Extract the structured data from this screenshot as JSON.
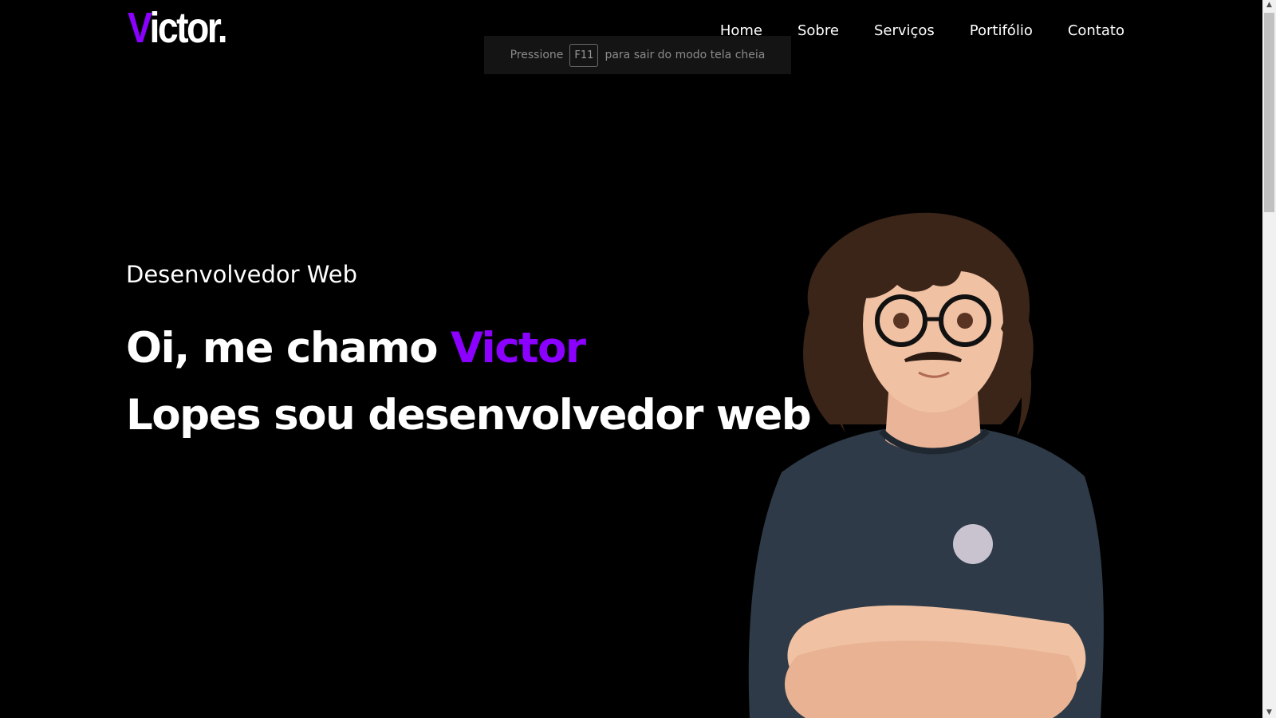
{
  "logo": {
    "accent": "V",
    "rest": "ictor."
  },
  "nav": [
    {
      "label": "Home"
    },
    {
      "label": "Sobre"
    },
    {
      "label": "Serviços"
    },
    {
      "label": "Portifólio"
    },
    {
      "label": "Contato"
    }
  ],
  "fullscreen_notice": {
    "before": "Pressione",
    "key": "F11",
    "after": "para sair do modo tela cheia"
  },
  "hero": {
    "subtitle": "Desenvolvedor Web",
    "headline_part1": "Oi, me chamo ",
    "headline_name": "Victor",
    "headline_part2": "Lopes sou desenvolvedor web"
  },
  "colors": {
    "accent": "#8b00ff",
    "background": "#000000"
  },
  "icons": {
    "scroll_up": "scroll-up-arrow-icon",
    "scroll_down": "scroll-down-arrow-icon"
  }
}
